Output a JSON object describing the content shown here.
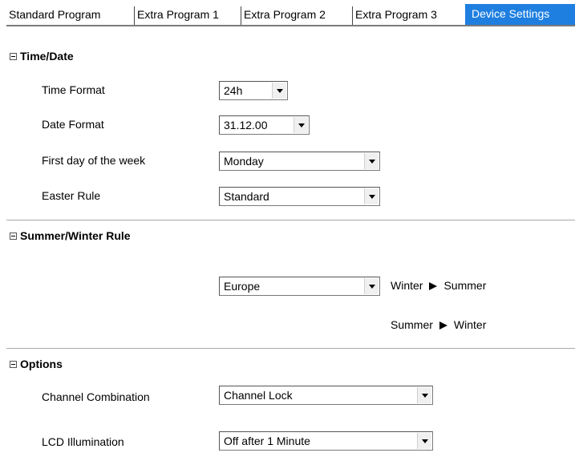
{
  "tabs": [
    {
      "label": "Standard Program"
    },
    {
      "label": "Extra Program 1"
    },
    {
      "label": "Extra Program 2"
    },
    {
      "label": "Extra Program 3"
    },
    {
      "label": "Device Settings",
      "active": true
    }
  ],
  "sections": {
    "time_date": {
      "title": "Time/Date",
      "time_format": {
        "label": "Time Format",
        "value": "24h"
      },
      "date_format": {
        "label": "Date Format",
        "value": "31.12.00"
      },
      "first_day": {
        "label": "First day of the week",
        "value": "Monday"
      },
      "easter_rule": {
        "label": "Easter Rule",
        "value": "Standard"
      }
    },
    "summer_winter": {
      "title": "Summer/Winter Rule",
      "region": {
        "value": "Europe"
      },
      "transition_1": {
        "from": "Winter",
        "to": "Summer"
      },
      "transition_2": {
        "from": "Summer",
        "to": "Winter"
      }
    },
    "options": {
      "title": "Options",
      "channel_combination": {
        "label": "Channel Combination",
        "value": "Channel Lock"
      },
      "lcd_illumination": {
        "label": "LCD Illumination",
        "value": "Off after 1 Minute"
      }
    }
  },
  "colors": {
    "active_tab": "#1e7fe0",
    "divider": "#a9a9a9"
  }
}
